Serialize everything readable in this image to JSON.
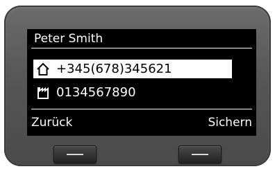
{
  "contact": {
    "name": "Peter Smith",
    "entries": [
      {
        "icon": "home-phone-icon",
        "number": "+345(678)345621"
      },
      {
        "icon": "office-phone-icon",
        "number": "0134567890"
      }
    ]
  },
  "softkeys": {
    "left": "Zurück",
    "right": "Sichern"
  }
}
